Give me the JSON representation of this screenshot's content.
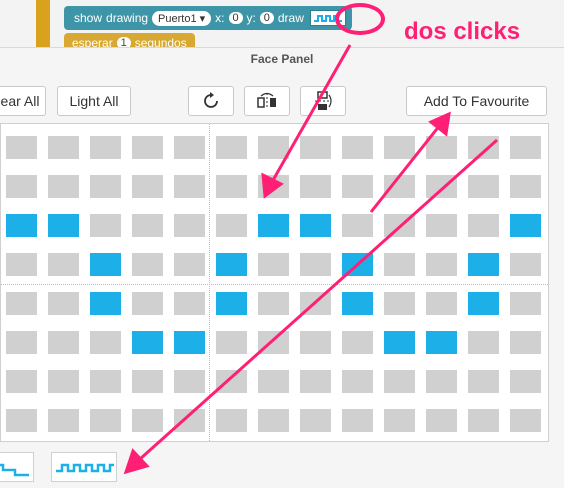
{
  "block": {
    "show_label": "show",
    "drawing_label": "drawing",
    "port_value": "Puerto1",
    "x_label": "x:",
    "x_value": "0",
    "y_label": "y:",
    "y_value": "0",
    "draw_label": "draw"
  },
  "block2": {
    "label": "esperar",
    "value": "1",
    "unit": "segundos"
  },
  "annotation": {
    "text": "dos clicks",
    "color": "#ff1f74"
  },
  "panel": {
    "title": "Face Panel",
    "clear_all_label": "ear All",
    "light_all_label": "Light All",
    "add_favourite_label": "Add To Favourite"
  },
  "grid": {
    "rows": 8,
    "cols": 13,
    "on_color": "#1db0e8",
    "off_color": "#d0d0d0",
    "lit": [
      [
        2,
        0
      ],
      [
        2,
        1
      ],
      [
        2,
        6
      ],
      [
        2,
        7
      ],
      [
        2,
        12
      ],
      [
        3,
        2
      ],
      [
        3,
        5
      ],
      [
        3,
        8
      ],
      [
        3,
        11
      ],
      [
        4,
        2
      ],
      [
        4,
        5
      ],
      [
        4,
        8
      ],
      [
        4,
        11
      ],
      [
        5,
        3
      ],
      [
        5,
        4
      ],
      [
        5,
        9
      ],
      [
        5,
        10
      ]
    ]
  },
  "icons": {
    "rotate": "rotate-icon",
    "flip_horizontal": "flip-horizontal-icon",
    "flip_vertical": "flip-vertical-icon"
  }
}
